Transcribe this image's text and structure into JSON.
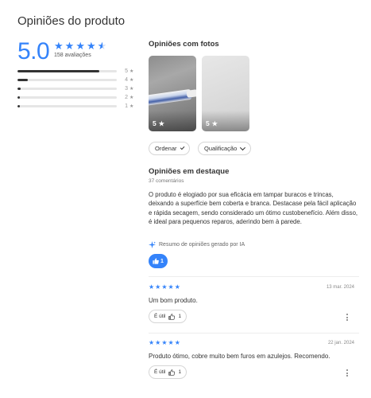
{
  "page_title": "Opiniões do produto",
  "summary": {
    "average": "5.0",
    "rating_value": 4.6,
    "count_text": "158 avaliações",
    "distribution": [
      {
        "label": "5",
        "fraction": 0.82
      },
      {
        "label": "4",
        "fraction": 0.1
      },
      {
        "label": "3",
        "fraction": 0.03
      },
      {
        "label": "2",
        "fraction": 0.02
      },
      {
        "label": "1",
        "fraction": 0.02
      }
    ]
  },
  "photos": {
    "title": "Opiniões com fotos",
    "items": [
      {
        "rating": "5"
      },
      {
        "rating": "5"
      }
    ]
  },
  "filters": {
    "sort_label": "Ordenar",
    "rating_label": "Qualificação"
  },
  "featured": {
    "title": "Opiniões em destaque",
    "count_text": "37 comentários",
    "ai_summary": "O produto é elogiado por sua eficácia em tampar buracos e trincas, deixando a superfície bem coberta e branca. Destacase pela fácil aplicação e rápida secagem, sendo considerado um ótimo custobenefício. Além disso, é ideal para pequenos reparos, aderindo bem à parede.",
    "ai_note": "Resumo de opiniões gerado por IA",
    "ai_likes": "1"
  },
  "reviews": [
    {
      "stars": 5,
      "date": "13 mar. 2024",
      "text": "Um bom produto.",
      "helpful_label": "É útil",
      "helpful_count": "1"
    },
    {
      "stars": 5,
      "date": "22 jan. 2024",
      "text": "Produto ótimo, cobre muito bem furos em azulejos. Recomendo.",
      "helpful_label": "É útil",
      "helpful_count": "1"
    }
  ],
  "colors": {
    "accent": "#3483fa",
    "text": "#333333",
    "muted": "#999999"
  },
  "icons": [
    "star-icon",
    "chevron-down-icon",
    "sparkle-icon",
    "thumbs-up-icon",
    "more-vertical-icon"
  ]
}
